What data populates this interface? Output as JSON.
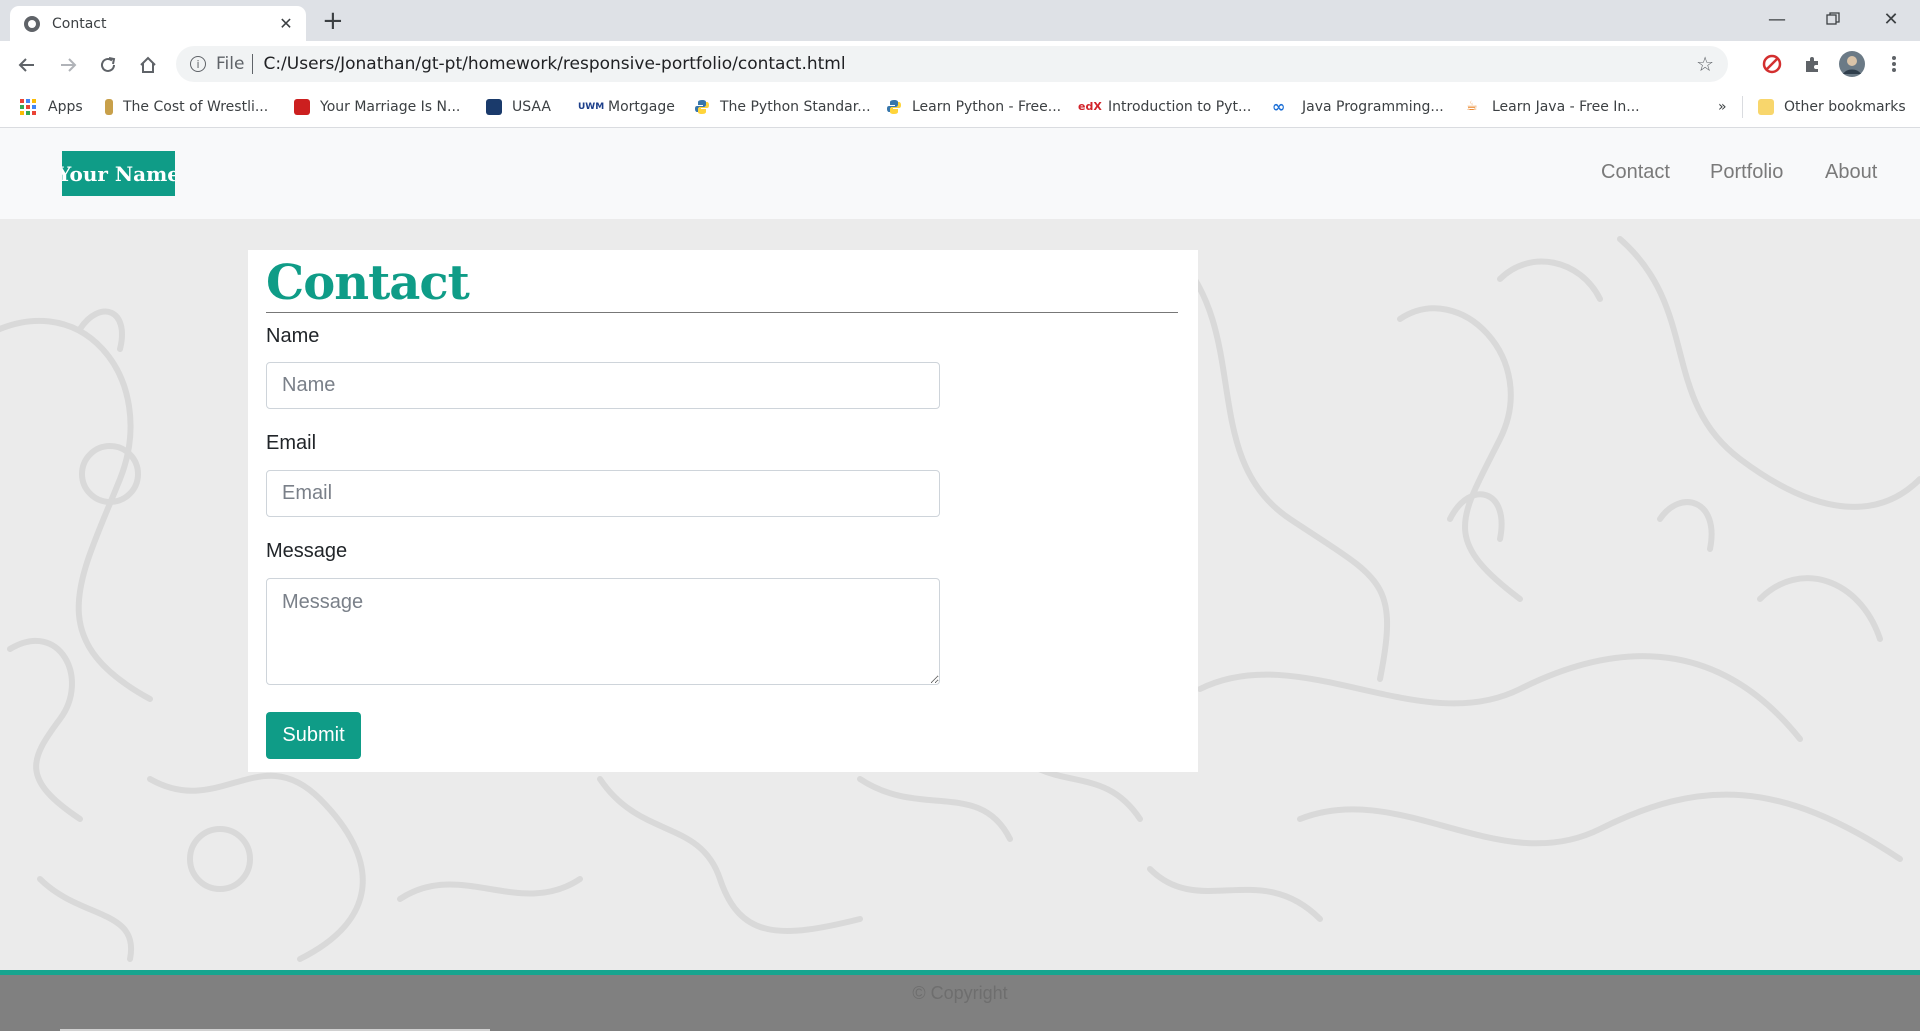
{
  "browser": {
    "tab_title": "Contact",
    "url_scheme": "File",
    "url": "C:/Users/Jonathan/gt-pt/homework/responsive-portfolio/contact.html",
    "bookmarks": [
      {
        "label": "Apps",
        "icon": "apps-grid-icon"
      },
      {
        "label": "The Cost of Wrestli...",
        "icon": "bookmark-r-icon",
        "color": "#c8a04a"
      },
      {
        "label": "Your Marriage Is N...",
        "icon": "bookmark-red-icon",
        "color": "#cc1f1f"
      },
      {
        "label": "USAA",
        "icon": "usaa-icon",
        "color": "#1a3a6b"
      },
      {
        "label": "Mortgage",
        "icon": "uwm-icon",
        "color": "#1d3f8a"
      },
      {
        "label": "The Python Standar...",
        "icon": "python-icon",
        "color": "#3776ab"
      },
      {
        "label": "Learn Python - Free...",
        "icon": "python-icon",
        "color": "#3776ab"
      },
      {
        "label": "Introduction to Pyt...",
        "icon": "edx-icon",
        "color": "#d2232a"
      },
      {
        "label": "Java Programming...",
        "icon": "infinity-icon",
        "color": "#1c6fd6"
      },
      {
        "label": "Learn Java - Free In...",
        "icon": "java-icon",
        "color": "#e76f00"
      }
    ],
    "more_bookmarks": "»",
    "other_bookmarks": "Other bookmarks"
  },
  "site": {
    "brand": "Your Name",
    "nav": [
      "Contact",
      "Portfolio",
      "About"
    ],
    "page_title": "Contact",
    "form": {
      "name_label": "Name",
      "name_placeholder": "Name",
      "email_label": "Email",
      "email_placeholder": "Email",
      "message_label": "Message",
      "message_placeholder": "Message",
      "submit_label": "Submit"
    },
    "footer": "© Copyright"
  },
  "colors": {
    "accent": "#0f9c87",
    "footer_bg": "#808080",
    "footer_border": "#17a58f",
    "page_bg": "#ebebeb"
  }
}
